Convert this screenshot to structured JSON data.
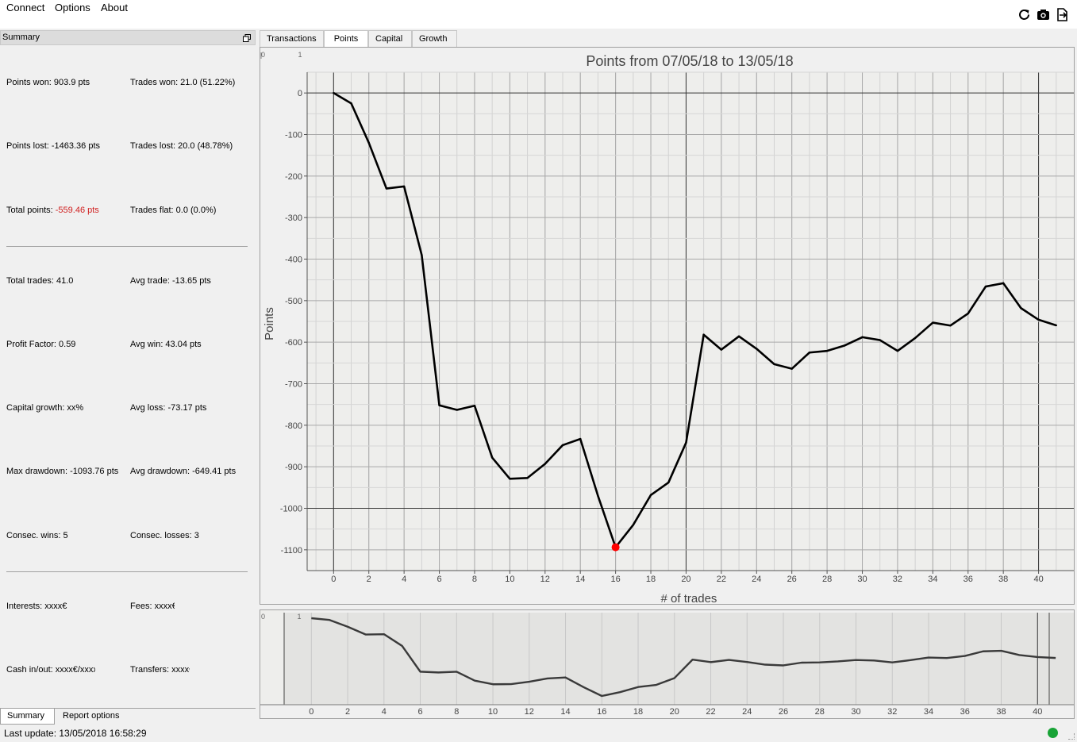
{
  "menu": {
    "items": [
      "Connect",
      "Options",
      "About"
    ]
  },
  "toolbar": {
    "icons": [
      "refresh-icon",
      "camera-icon",
      "export-icon"
    ]
  },
  "summary": {
    "dock_title": "Summary",
    "stats": {
      "points_won": "Points won: 903.9 pts",
      "trades_won": "Trades won: 21.0 (51.22%)",
      "points_lost": "Points lost: -1463.36 pts",
      "trades_lost": "Trades lost: 20.0 (48.78%)",
      "total_points_label": "Total points: ",
      "total_points_value": "-559.46 pts",
      "trades_flat": "Trades flat: 0.0 (0.0%)",
      "total_trades": "Total trades: 41.0",
      "avg_trade": "Avg trade: -13.65 pts",
      "profit_factor": "Profit Factor: 0.59",
      "avg_win": "Avg win: 43.04 pts",
      "capital_growth": "Capital growth: xx%",
      "avg_loss": "Avg loss: -73.17 pts",
      "max_drawdown": "Max drawdown: -1093.76 pts",
      "avg_drawdown": "Avg drawdown: -649.41 pts",
      "consec_wins": "Consec. wins: 5",
      "consec_losses": "Consec. losses: 3",
      "interests": "Interests: xxxx€",
      "fees": "Fees: xxxx€",
      "cash_inout": "Cash in/out: xxxx€/xxxx€",
      "transfers": "Transfers: xxxx€"
    },
    "negative_color": "#d02020"
  },
  "bottom_tabs": [
    "Summary",
    "Report options"
  ],
  "status": {
    "last_update": "Last update: 13/05/2018 16:58:29",
    "connection_color": "#18a336"
  },
  "tabs": [
    "Transactions",
    "Points",
    "Capital",
    "Growth"
  ],
  "active_tab": "Points",
  "corner_labels": {
    "zero": "0",
    "one": "1"
  },
  "chart_data": {
    "type": "line",
    "title": "Points from 07/05/18 to 13/05/18",
    "xlabel": "# of trades",
    "ylabel": "Points",
    "xlim": [
      -1.5,
      42
    ],
    "ylim": [
      -1150,
      50
    ],
    "xticks": [
      0,
      2,
      4,
      6,
      8,
      10,
      12,
      14,
      16,
      18,
      20,
      22,
      24,
      26,
      28,
      30,
      32,
      34,
      36,
      38,
      40
    ],
    "yticks": [
      0,
      -100,
      -200,
      -300,
      -400,
      -500,
      -600,
      -700,
      -800,
      -900,
      -1000,
      -1100
    ],
    "grid": true,
    "line_color": "#000000",
    "marker": {
      "x": 16,
      "y": -1093.76,
      "color": "#ff0000"
    },
    "series": [
      {
        "x": [
          0,
          1,
          2,
          3,
          4,
          5,
          6,
          7,
          8,
          9,
          10,
          11,
          12,
          13,
          14,
          15,
          16,
          17,
          18,
          19,
          20,
          21,
          22,
          23,
          24,
          25,
          26,
          27,
          28,
          29,
          30,
          31,
          32,
          33,
          34,
          35,
          36,
          37,
          38,
          39,
          40,
          41
        ],
        "values": [
          0,
          -25,
          -120,
          -230,
          -225,
          -390,
          -752,
          -763,
          -753,
          -878,
          -929,
          -927,
          -893,
          -848,
          -833,
          -970,
          -1093.76,
          -1040,
          -968,
          -938,
          -842,
          -582,
          -618,
          -586,
          -616,
          -653,
          -664,
          -625,
          -621,
          -608,
          -588,
          -595,
          -621,
          -590,
          -553,
          -560,
          -531,
          -466,
          -458,
          -518,
          -546,
          -559.46
        ]
      }
    ]
  },
  "navigator": {
    "xticks": [
      0,
      2,
      4,
      6,
      8,
      10,
      12,
      14,
      16,
      18,
      20,
      22,
      24,
      26,
      28,
      30,
      32,
      34,
      36,
      38,
      40
    ],
    "line_color": "#3a3a3a"
  }
}
